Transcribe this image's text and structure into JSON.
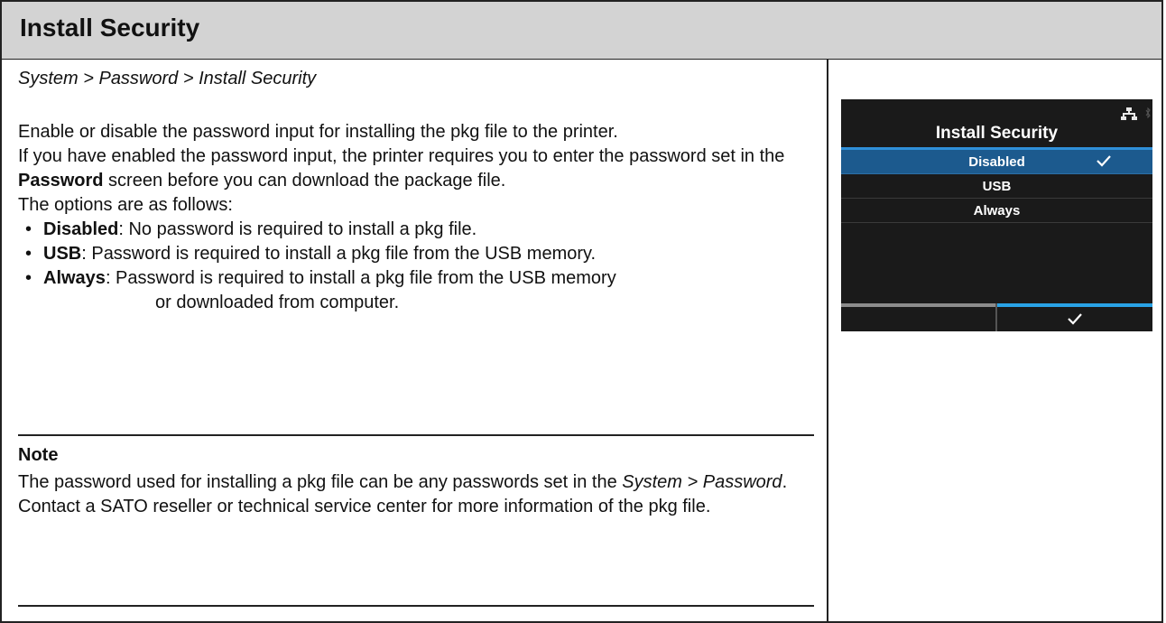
{
  "page": {
    "title": "Install Security",
    "breadcrumb": "System > Password > Install Security"
  },
  "description": {
    "line1": "Enable or disable the password input for installing the pkg file to the printer.",
    "line2_pre": "If you have enabled the password input, the printer requires you to enter the password set in the ",
    "line2_bold": "Password",
    "line2_post": " screen before you can download the package file.",
    "line3": "The options are as follows:"
  },
  "options": [
    {
      "name": "Disabled",
      "desc": ": No password is required to install a pkg file."
    },
    {
      "name": "USB",
      "desc": ": Password is required to install a pkg file from the USB memory."
    },
    {
      "name": "Always",
      "desc": ": Password is required to install a pkg file from the USB memory",
      "desc_cont": "or downloaded from computer."
    }
  ],
  "note": {
    "title": "Note",
    "line1_pre": "The password used for installing a pkg file can be any passwords set in the ",
    "line1_italic": "System > Password",
    "line1_post": ".",
    "line2": "Contact a SATO reseller or technical service center for more information of the pkg file."
  },
  "lcd": {
    "title": "Install Security",
    "items": [
      {
        "label": "Disabled",
        "selected": true
      },
      {
        "label": "USB",
        "selected": false
      },
      {
        "label": "Always",
        "selected": false
      }
    ],
    "icons": [
      "network-icon",
      "bluetooth-icon",
      "check-icon"
    ],
    "colors": {
      "background": "#1a1a1a",
      "selected": "#1c5a8e",
      "accent": "#29a3e6"
    }
  }
}
